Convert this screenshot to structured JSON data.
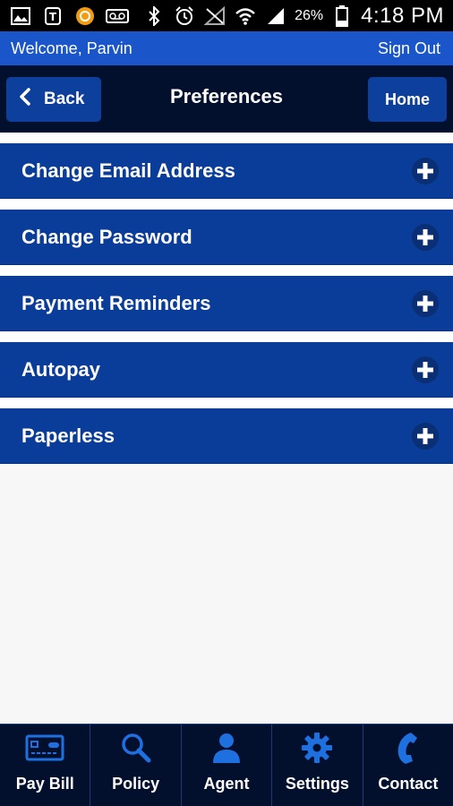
{
  "status_bar": {
    "battery_percent": "26%",
    "time": "4:18 PM",
    "icons": [
      "image-icon",
      "tmobile-icon",
      "audible-icon",
      "voicemail-icon",
      "bluetooth-icon",
      "alarm-icon",
      "no-signal-icon",
      "wifi-icon",
      "cell-signal-icon",
      "battery-icon"
    ]
  },
  "welcome": {
    "greeting": "Welcome, Parvin",
    "signout_label": "Sign Out"
  },
  "header": {
    "back_label": "Back",
    "title": "Preferences",
    "home_label": "Home"
  },
  "preferences": [
    {
      "label": "Change Email Address"
    },
    {
      "label": "Change Password"
    },
    {
      "label": "Payment Reminders"
    },
    {
      "label": "Autopay"
    },
    {
      "label": "Paperless"
    }
  ],
  "bottom_nav": [
    {
      "label": "Pay Bill",
      "icon": "credit-card-icon"
    },
    {
      "label": "Policy",
      "icon": "magnifier-icon"
    },
    {
      "label": "Agent",
      "icon": "person-icon"
    },
    {
      "label": "Settings",
      "icon": "gear-icon"
    },
    {
      "label": "Contact",
      "icon": "phone-icon"
    }
  ],
  "colors": {
    "accent_blue": "#1a55c9",
    "header_dark": "#02102e",
    "item_blue": "#0a3d99",
    "icon_blue": "#1e6fe0"
  }
}
